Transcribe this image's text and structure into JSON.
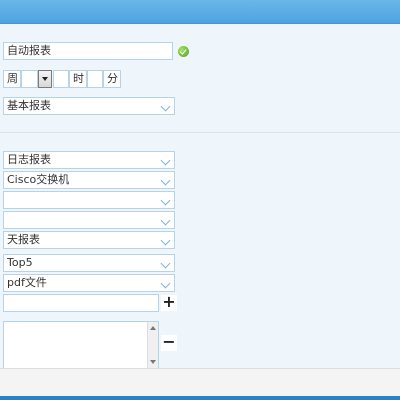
{
  "form": {
    "report_name": "自动报表",
    "schedule": {
      "week_label": "周",
      "hour_label": "时",
      "minute_label": "分"
    },
    "report_category": "基本报表"
  },
  "report_settings": {
    "selects": [
      {
        "value": "日志报表"
      },
      {
        "value": "Cisco交换机"
      },
      {
        "value": ""
      },
      {
        "value": ""
      },
      {
        "value": "天报表"
      },
      {
        "value": "Top5"
      },
      {
        "value": "pdf文件"
      }
    ],
    "add_button": "+",
    "remove_button": "−"
  },
  "colors": {
    "header": "#5aaae4",
    "page_bg": "#eef6fc",
    "input_border": "#b7d3ea",
    "ok": "#4fa21e"
  },
  "icons": {
    "ok": "checkmark-circle-icon",
    "dropdown": "chevron-down-icon",
    "add": "plus-icon",
    "remove": "minus-icon"
  }
}
